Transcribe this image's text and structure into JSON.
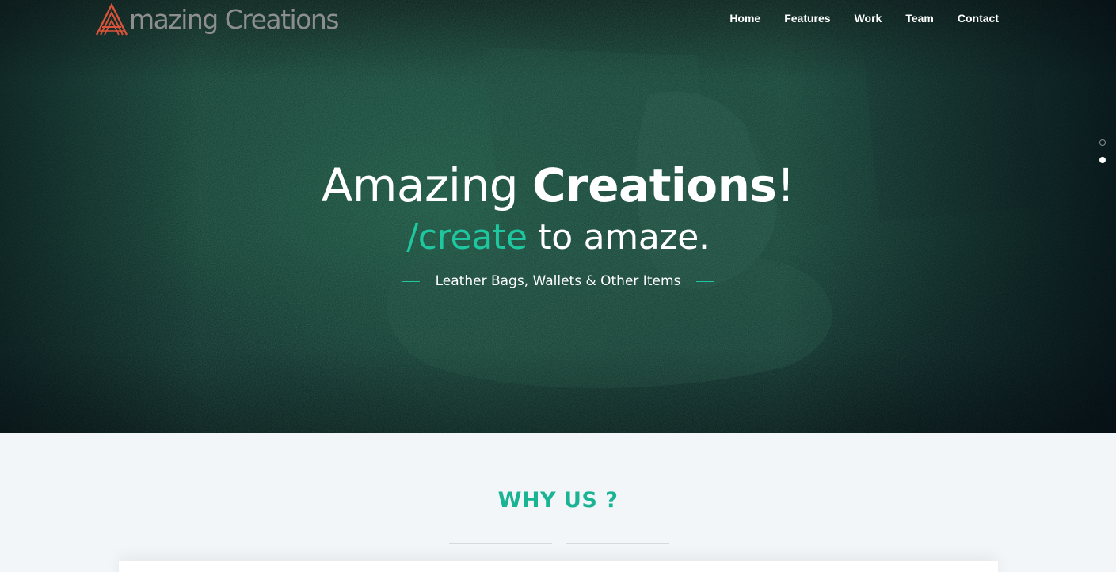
{
  "brand": {
    "name": "Amazing Creations",
    "logo_letter": "A",
    "logo_text": "mazing Creations",
    "logo_color": "#d9533a"
  },
  "nav": {
    "items": [
      {
        "label": "Home"
      },
      {
        "label": "Features"
      },
      {
        "label": "Work"
      },
      {
        "label": "Team"
      },
      {
        "label": "Contact"
      }
    ]
  },
  "hero": {
    "title_light": "Amazing ",
    "title_bold": "Creations",
    "title_end": "!",
    "subtitle_accent": "/create",
    "subtitle_rest": " to amaze.",
    "tagline": "Leather Bags, Wallets & Other Items",
    "accent_color": "#1fc7a0"
  },
  "slider": {
    "dots": 2,
    "active_index": 1
  },
  "why": {
    "title": "WHY US ?",
    "title_color": "#1ab394"
  }
}
